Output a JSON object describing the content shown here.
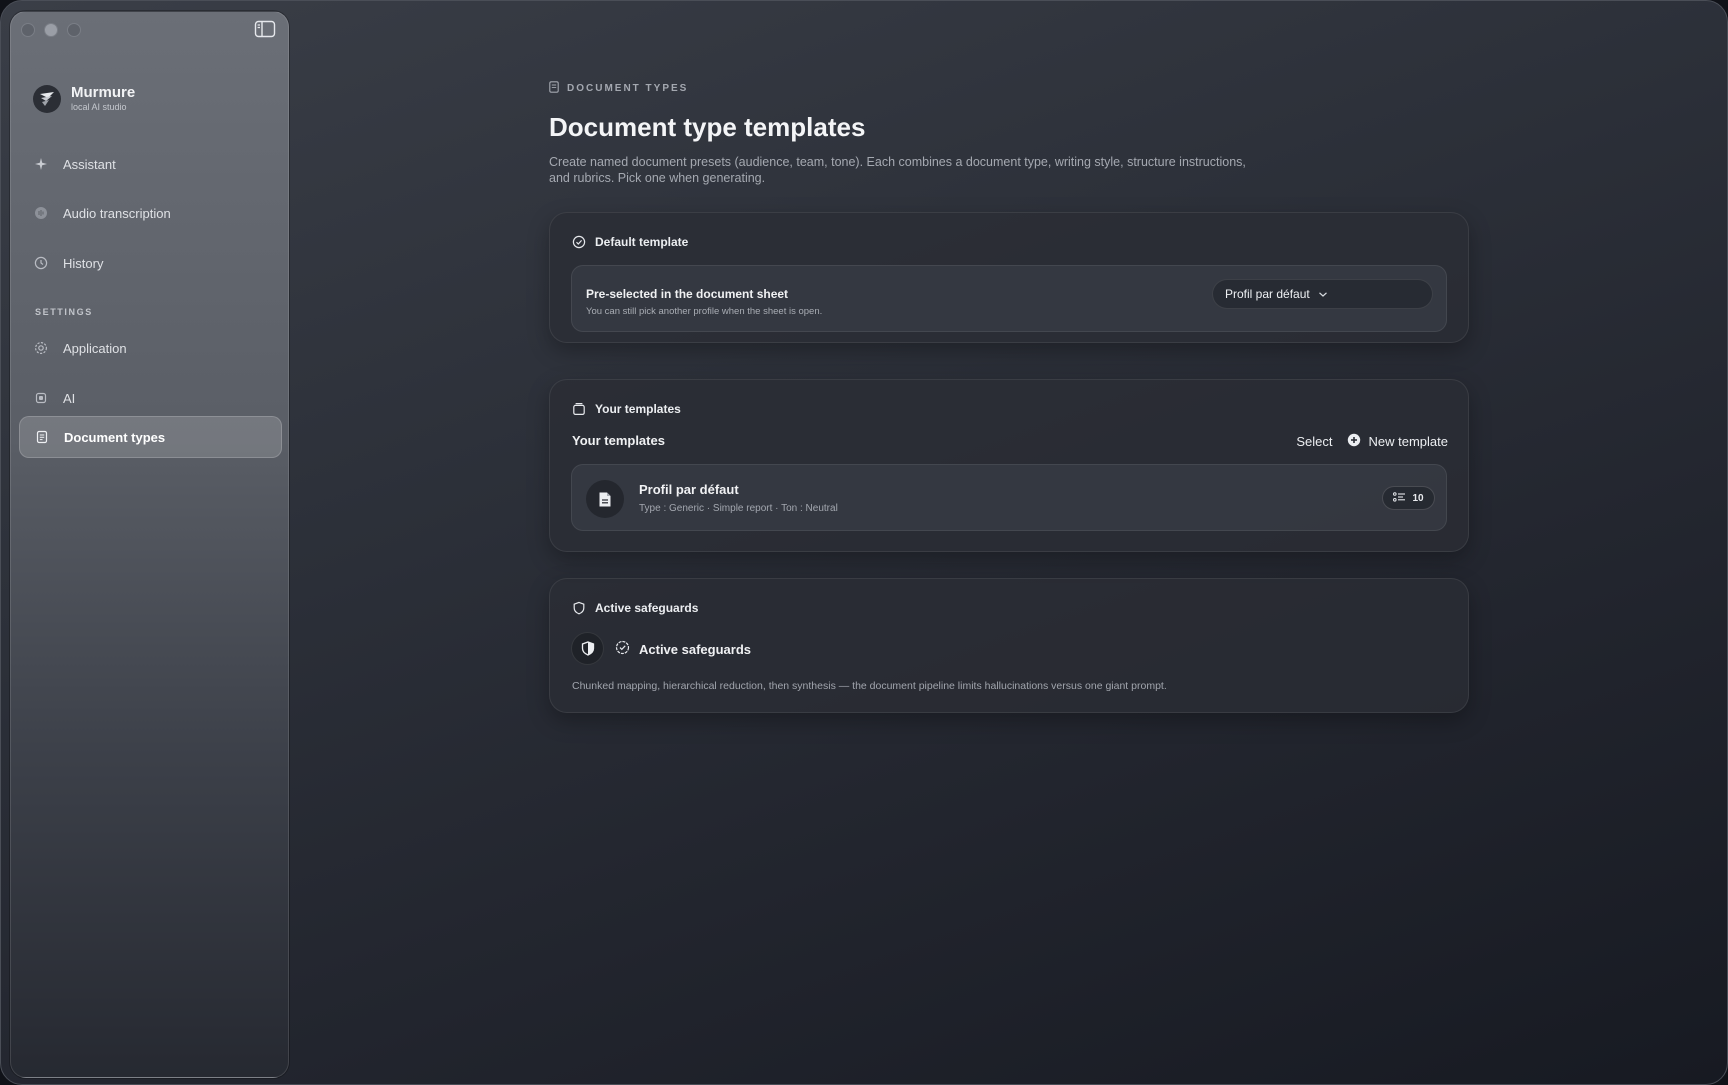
{
  "app": {
    "name": "Murmure",
    "subtitle": "local AI studio"
  },
  "sidebar": {
    "items": [
      {
        "label": "Assistant",
        "icon": "sparkle-icon"
      },
      {
        "label": "Audio transcription",
        "icon": "waveform-icon"
      },
      {
        "label": "History",
        "icon": "clock-icon"
      }
    ],
    "settings_label": "SETTINGS",
    "settings_items": [
      {
        "label": "Application",
        "icon": "gear-icon"
      },
      {
        "label": "AI",
        "icon": "chip-icon"
      },
      {
        "label": "Document types",
        "icon": "document-icon",
        "active": true
      }
    ]
  },
  "header": {
    "eyebrow": "DOCUMENT TYPES",
    "title": "Document type templates",
    "description": "Create named document presets (audience, team, tone). Each combines a document type, writing style, structure instructions, and rubrics. Pick one when generating."
  },
  "default_template": {
    "heading": "Default template",
    "row_title": "Pre-selected in the document sheet",
    "row_subtitle": "You can still pick another profile when the sheet is open.",
    "selected_value": "Profil par défaut"
  },
  "templates": {
    "heading": "Your templates",
    "list_title": "Your templates",
    "select_label": "Select",
    "new_label": "New template",
    "items": [
      {
        "name": "Profil par défaut",
        "meta": "Type : Generic · Simple report · Ton : Neutral",
        "count": "10"
      }
    ]
  },
  "safeguards": {
    "heading": "Active safeguards",
    "title": "Active safeguards",
    "description": "Chunked mapping, hierarchical reduction, then synthesis — the document pipeline limits hallucinations versus one giant prompt."
  },
  "colors": {
    "accent_text": "#f0f1f3",
    "muted_text": "#a5a9b1",
    "card_bg": "#2a2d35",
    "sidebar_active": "#7a7e86"
  }
}
